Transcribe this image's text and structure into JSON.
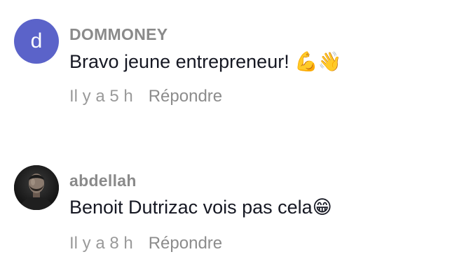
{
  "comments": [
    {
      "avatar": {
        "type": "letter",
        "letter": "d",
        "color": "#5b63c9"
      },
      "username": "DOMMONEY",
      "text": "Bravo jeune entrepreneur! 💪👋",
      "time": "Il y a 5 h",
      "reply_label": "Répondre"
    },
    {
      "avatar": {
        "type": "photo",
        "icon": "user-photo-avatar"
      },
      "username": "abdellah",
      "text": "Benoit Dutrizac vois pas cela😁",
      "time": "Il y a 8 h",
      "reply_label": "Répondre"
    }
  ]
}
